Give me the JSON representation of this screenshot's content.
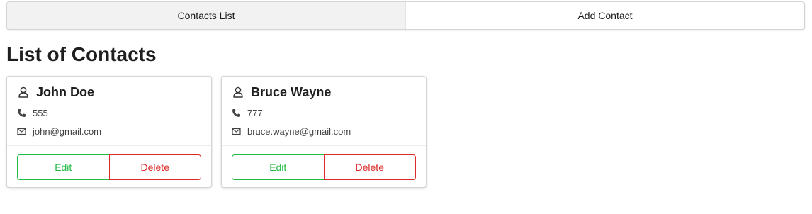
{
  "tabs": [
    {
      "label": "Contacts List",
      "active": true
    },
    {
      "label": "Add Contact",
      "active": false
    }
  ],
  "page_title": "List of Contacts",
  "contacts": [
    {
      "name": "John Doe",
      "phone": "555",
      "email": "john@gmail.com",
      "edit_label": "Edit",
      "delete_label": "Delete"
    },
    {
      "name": "Bruce Wayne",
      "phone": "777",
      "email": "bruce.wayne@gmail.com",
      "edit_label": "Edit",
      "delete_label": "Delete"
    }
  ],
  "icons": {
    "person": "user-icon",
    "phone": "phone-icon",
    "email": "envelope-icon"
  },
  "colors": {
    "edit": "#21ba45",
    "delete": "#db2828",
    "active_tab": "#f2f2f2"
  }
}
